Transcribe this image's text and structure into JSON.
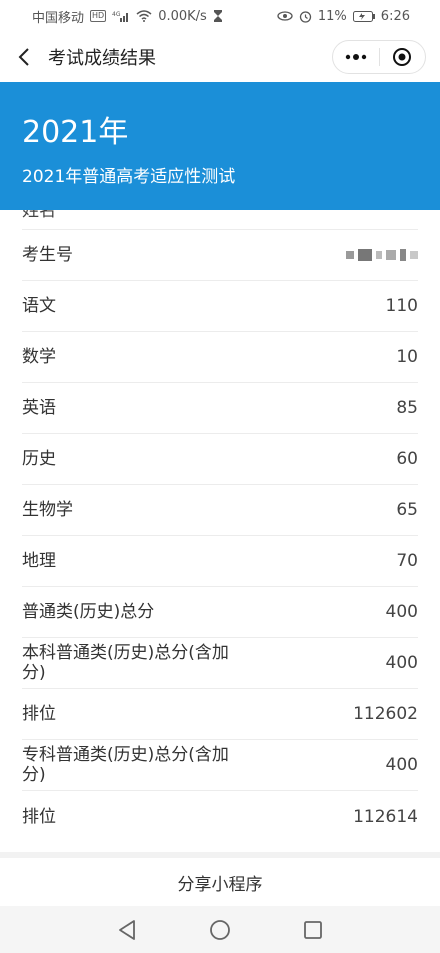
{
  "status_bar": {
    "carrier": "中国移动",
    "network_badge": "HD",
    "signal_label": "4G",
    "speed": "0.00K/s",
    "battery": "11%",
    "time": "6:26"
  },
  "nav": {
    "title": "考试成绩结果"
  },
  "banner": {
    "year": "2021年",
    "subtitle": "2021年普通高考适应性测试"
  },
  "partial_row": {
    "label": "姓名",
    "value": "***"
  },
  "rows": [
    {
      "label": "考生号",
      "value": ""
    },
    {
      "label": "语文",
      "value": "110"
    },
    {
      "label": "数学",
      "value": "10"
    },
    {
      "label": "英语",
      "value": "85"
    },
    {
      "label": "历史",
      "value": "60"
    },
    {
      "label": "生物学",
      "value": "65"
    },
    {
      "label": "地理",
      "value": "70"
    },
    {
      "label": "普通类(历史)总分",
      "value": "400"
    },
    {
      "label": "本科普通类(历史)总分(含加分)",
      "value": "400"
    },
    {
      "label": "排位",
      "value": "112602"
    },
    {
      "label": "专科普通类(历史)总分(含加分)",
      "value": "400"
    },
    {
      "label": "排位",
      "value": "112614"
    }
  ],
  "share": {
    "label": "分享小程序"
  },
  "colors": {
    "banner": "#1b8fd8",
    "divider": "#ececec"
  }
}
